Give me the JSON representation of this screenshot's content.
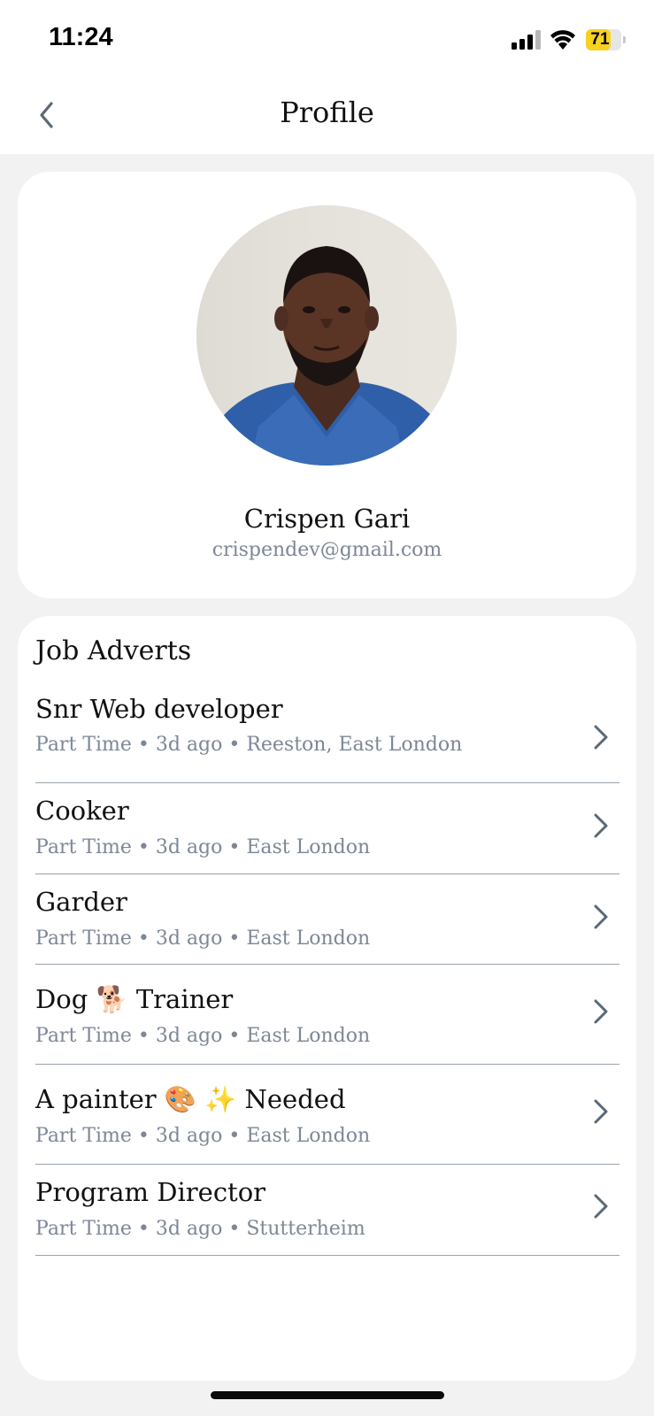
{
  "status_bar": {
    "time": "11:24",
    "battery_level": "71",
    "battery_fill_fraction": 0.71,
    "battery_color": "#f7d21e"
  },
  "header": {
    "title": "Profile",
    "back_icon": "chevron-left-icon"
  },
  "profile": {
    "name": "Crispen Gari",
    "email": "crispendev@gmail.com",
    "avatar": "profile-photo"
  },
  "job_adverts": {
    "title": "Job Adverts",
    "items": [
      {
        "title": "Snr Web developer",
        "meta": "Part Time • 3d ago • Reeston, East London"
      },
      {
        "title": "Cooker",
        "meta": "Part Time • 3d ago • East London"
      },
      {
        "title": "Garder",
        "meta": "Part Time • 3d ago • East London"
      },
      {
        "title": "Dog 🐕 Trainer",
        "meta": "Part Time • 3d ago • East London"
      },
      {
        "title": "A painter 🎨 ✨ Needed",
        "meta": "Part Time • 3d ago • East London"
      },
      {
        "title": "Program Director",
        "meta": "Part Time • 3d ago • Stutterheim"
      }
    ]
  },
  "colors": {
    "background": "#f2f2f2",
    "card": "#ffffff",
    "secondary_text": "#7d8797",
    "divider": "#9aa3ad"
  }
}
